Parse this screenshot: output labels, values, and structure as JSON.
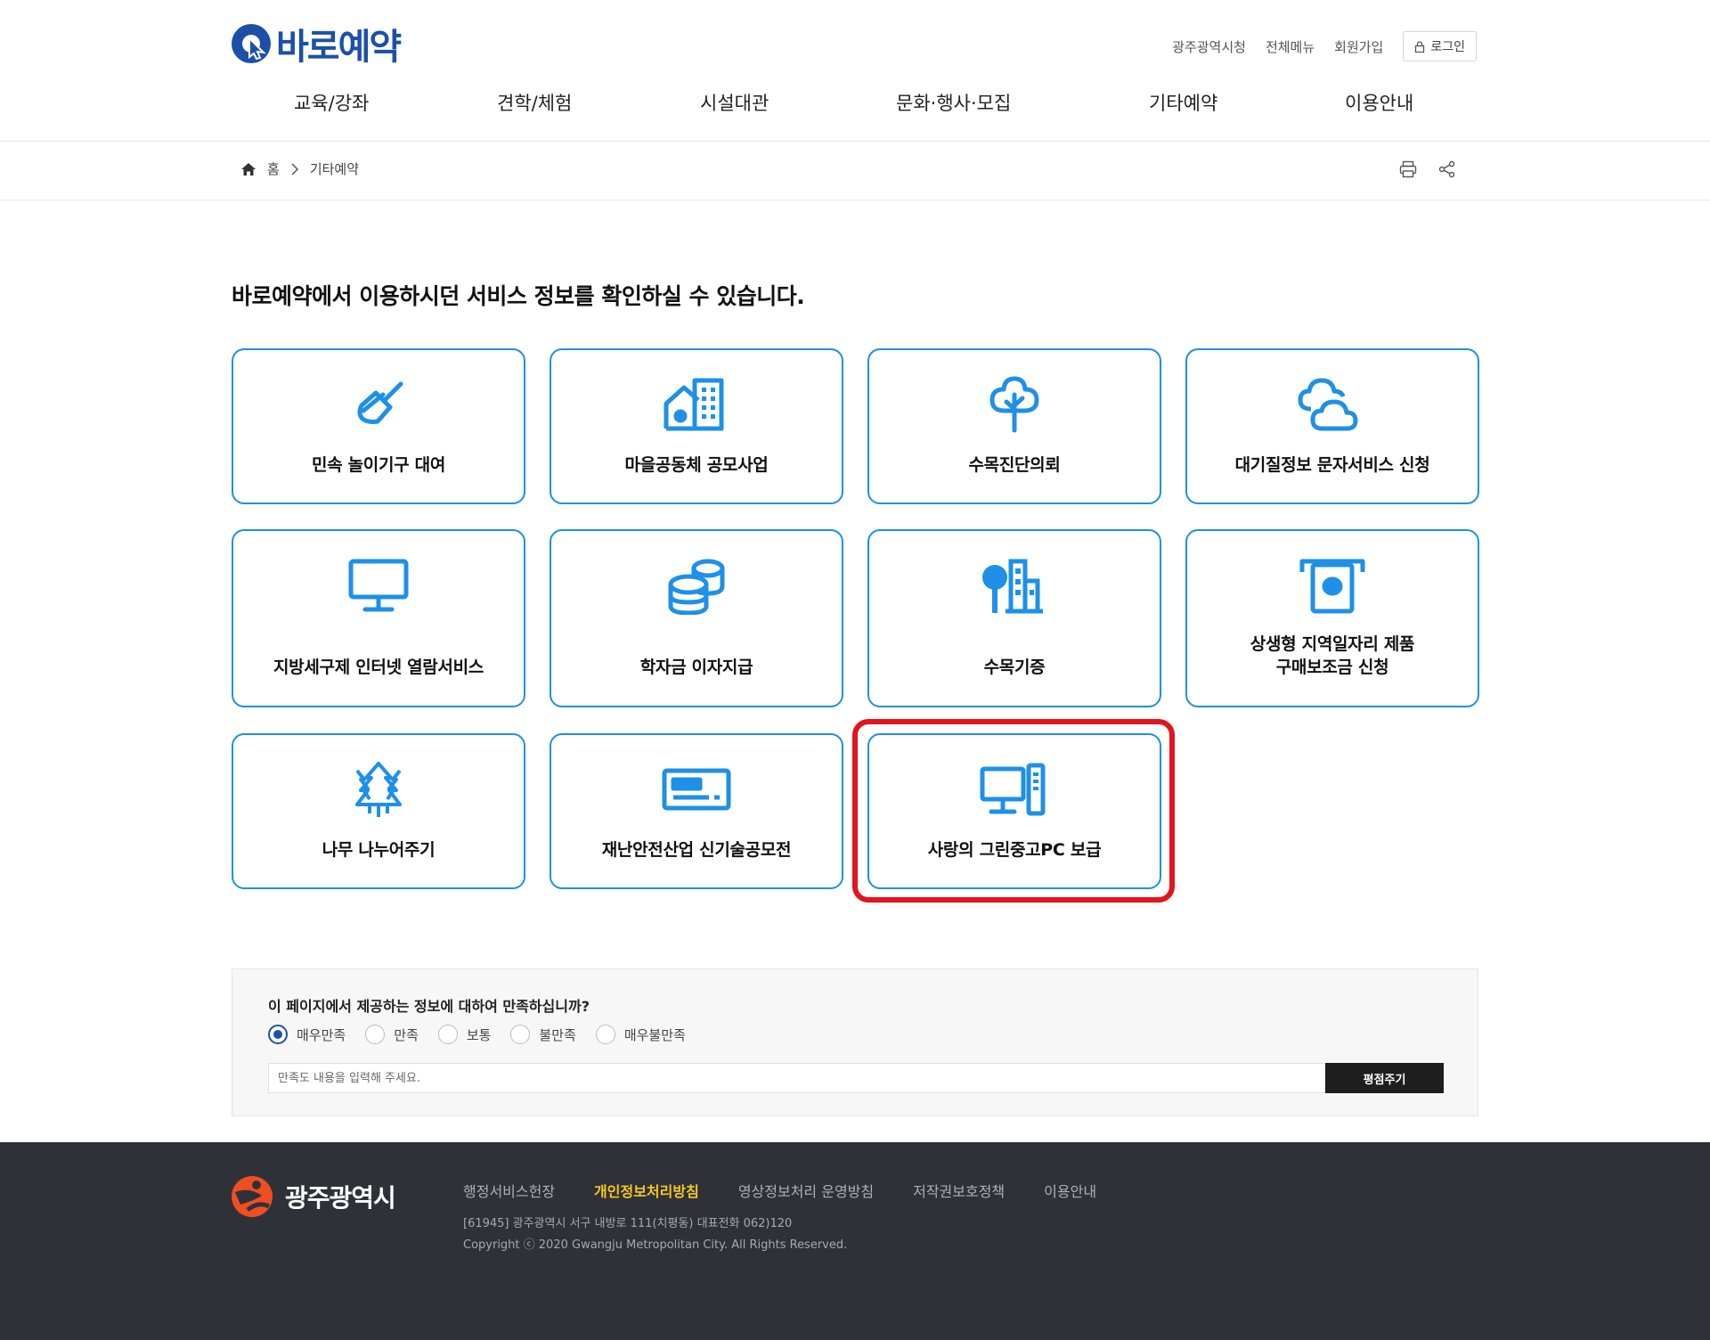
{
  "header": {
    "logo_text": "바로예약",
    "util_links": [
      "광주광역시청",
      "전체메뉴",
      "회원가입"
    ],
    "login_label": "로그인",
    "gnb": [
      "교육/강좌",
      "견학/체험",
      "시설대관",
      "문화·행사·모집",
      "기타예약",
      "이용안내"
    ]
  },
  "breadcrumb": {
    "home": "홈",
    "current": "기타예약"
  },
  "main": {
    "headline": "바로예약에서 이용하시던 서비스 정보를 확인하실 수 있습니다.",
    "cards": [
      {
        "label": "민속 놀이기구 대여",
        "icon": "toy-top-icon"
      },
      {
        "label": "마을공동체 공모사업",
        "icon": "community-building-icon"
      },
      {
        "label": "수목진단의뢰",
        "icon": "tree-icon"
      },
      {
        "label": "대기질정보 문자서비스 신청",
        "icon": "cloud-icon"
      },
      {
        "label": "지방세구제 인터넷 열람서비스",
        "icon": "monitor-icon"
      },
      {
        "label": "학자금 이자지급",
        "icon": "coin-stack-icon"
      },
      {
        "label": "수목기증",
        "icon": "city-tree-icon"
      },
      {
        "label": "상생형 지역일자리 제품\n구매보조금 신청",
        "label_line1": "상생형 지역일자리 제품",
        "label_line2": "구매보조금 신청",
        "icon": "cash-withdraw-icon"
      },
      {
        "label": "나무 나누어주기",
        "icon": "forest-icon"
      },
      {
        "label": "재난안전산업 신기술공모전",
        "icon": "card-reader-icon"
      },
      {
        "label": "사랑의 그린중고PC 보급",
        "icon": "desktop-pc-icon"
      }
    ]
  },
  "survey": {
    "question": "이 페이지에서 제공하는 정보에 대하여 만족하십니까?",
    "options": [
      "매우만족",
      "만족",
      "보통",
      "불만족",
      "매우불만족"
    ],
    "selected": "매우만족",
    "placeholder": "만족도 내용을 입력해 주세요.",
    "submit_label": "평점주기"
  },
  "footer": {
    "logo_text": "광주광역시",
    "links": [
      "행정서비스헌장",
      "개인정보처리방침",
      "영상정보처리 운영방침",
      "저작권보호정책",
      "이용안내"
    ],
    "address": "[61945] 광주광역시 서구 내방로 111(치평동) 대표전화 062)120",
    "copyright": "Copyright ⓒ 2020 Gwangju Metropolitan City. All Rights Reserved."
  },
  "colors": {
    "brand_blue": "#1c50a8",
    "card_border": "#1e90e8",
    "highlight_red": "#e2141e",
    "footer_bg": "#2f3139",
    "footer_emphasis": "#f6c91c"
  }
}
